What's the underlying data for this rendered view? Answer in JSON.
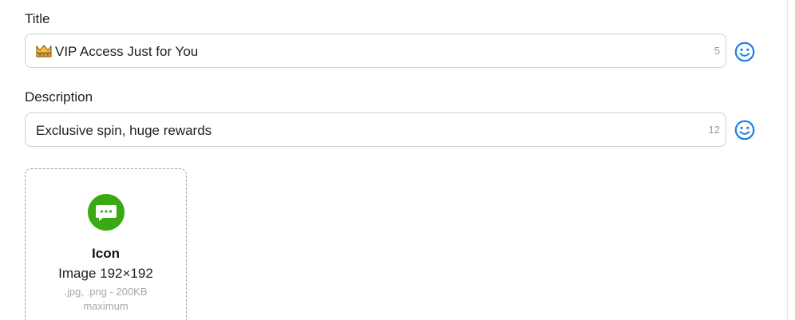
{
  "title_field": {
    "label": "Title",
    "emoji": "👑",
    "value": "VIP Access Just for You",
    "counter": "5",
    "emoji_button_icon": "smiley-icon"
  },
  "description_field": {
    "label": "Description",
    "value": "Exclusive spin, huge rewards",
    "counter": "12",
    "emoji_button_icon": "smiley-icon"
  },
  "icon_upload": {
    "icon": "chat-bubble-icon",
    "title": "Icon",
    "dimensions": "Image 192×192",
    "note": ".jpg, .png - 200KB maximum"
  },
  "colors": {
    "accent": "#1a7fe8",
    "upload_icon_bg": "#3aaa14"
  }
}
